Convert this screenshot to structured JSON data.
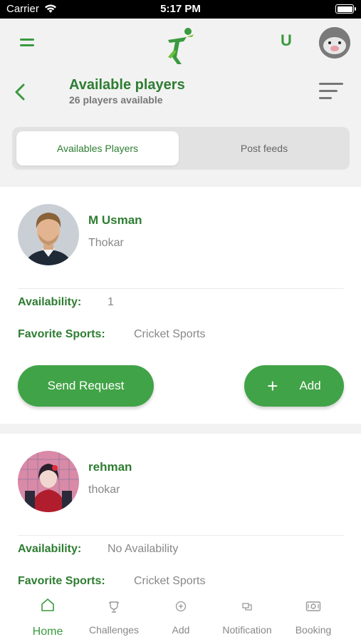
{
  "status_bar": {
    "carrier": "Carrier",
    "time": "5:17 PM"
  },
  "header": {
    "user_initial": "U"
  },
  "title": {
    "heading": "Available players",
    "subtitle": "26 players available"
  },
  "tabs": [
    {
      "label": "Availables Players",
      "active": true
    },
    {
      "label": "Post feeds",
      "active": false
    }
  ],
  "labels": {
    "availability": "Availability:",
    "favorite_sports": "Favorite Sports:"
  },
  "players": [
    {
      "name": "M Usman",
      "location": "Thokar",
      "availability": "1",
      "favorite_sports": "Cricket Sports"
    },
    {
      "name": "rehman",
      "location": "thokar",
      "availability": "No Availability",
      "favorite_sports": "Cricket Sports"
    }
  ],
  "actions": {
    "send_request": "Send Request",
    "add": "Add",
    "add_symbol": "+"
  },
  "bottom_nav": [
    {
      "label": "Home",
      "icon": "home-icon",
      "active": true
    },
    {
      "label": "Challenges",
      "icon": "trophy-icon",
      "active": false
    },
    {
      "label": "Add",
      "icon": "add-circle-icon",
      "active": false
    },
    {
      "label": "Notification",
      "icon": "notification-icon",
      "active": false
    },
    {
      "label": "Booking",
      "icon": "booking-icon",
      "active": false
    }
  ],
  "colors": {
    "primary": "#41a347",
    "title_green": "#2e7d32",
    "muted": "#888888",
    "background": "#f2f2f2"
  }
}
